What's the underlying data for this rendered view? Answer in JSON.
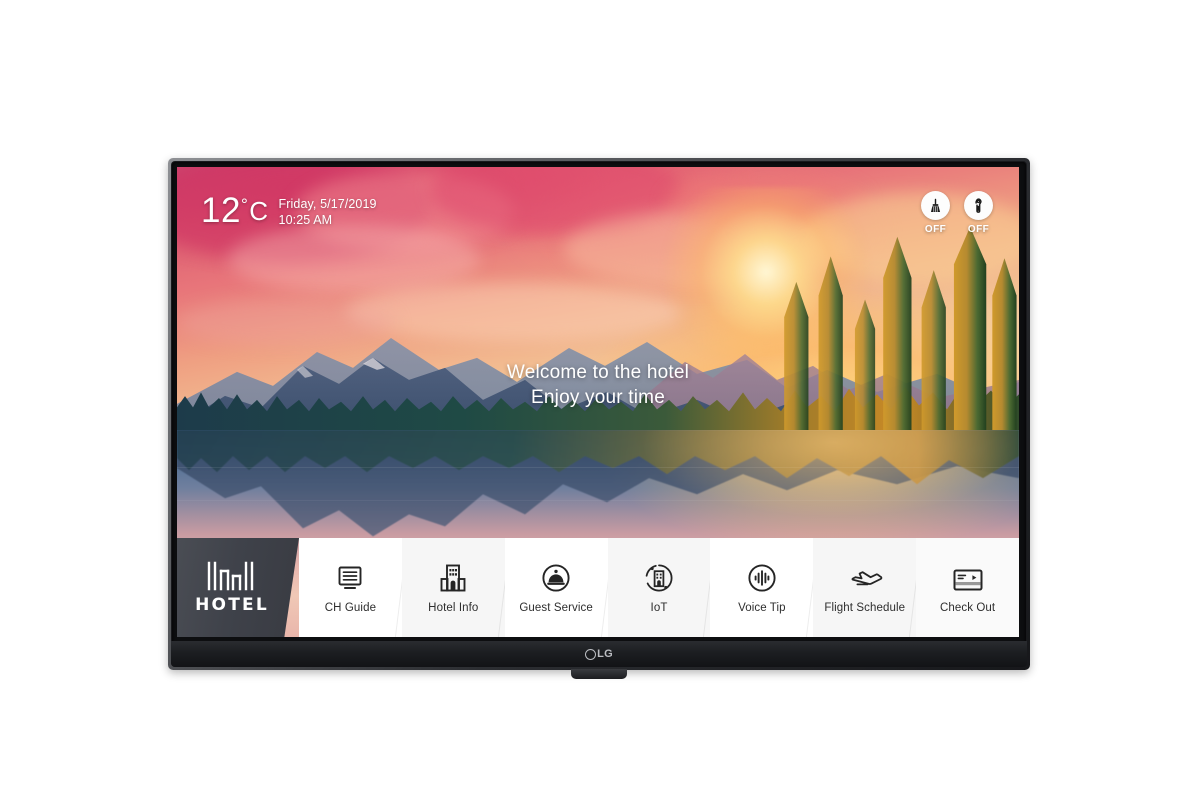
{
  "device": {
    "brand": "LG",
    "chassis_name": "lg-hotel-tv"
  },
  "screen": {
    "weather": {
      "temperature": "12",
      "degree_symbol": "°",
      "unit": "C",
      "date": "Friday, 5/17/2019",
      "time": "10:25 AM"
    },
    "status_icons": [
      {
        "name": "make-up-room-icon",
        "glyph": "broom",
        "state": "OFF"
      },
      {
        "name": "do-not-disturb-icon",
        "glyph": "door-hanger",
        "state": "OFF"
      }
    ],
    "welcome": {
      "line1": "Welcome to the hotel",
      "line2": "Enjoy your time"
    },
    "launcher": {
      "brand_tile": {
        "label": "HOTEL",
        "icon": "hotel-skyline-icon"
      },
      "tiles": [
        {
          "label": "CH Guide",
          "icon": "channel-guide-icon"
        },
        {
          "label": "Hotel Info",
          "icon": "building-icon"
        },
        {
          "label": "Guest Service",
          "icon": "service-bell-icon"
        },
        {
          "label": "IoT",
          "icon": "iot-building-icon"
        },
        {
          "label": "Voice Tip",
          "icon": "voice-waveform-icon"
        },
        {
          "label": "Flight Schedule",
          "icon": "airplane-icon"
        },
        {
          "label": "Check Out",
          "icon": "key-card-icon"
        }
      ]
    }
  },
  "colors": {
    "brand_tile_bg": "#3f424a",
    "launcher_bg": "#ffffff",
    "label_text": "#2e2e2e",
    "osd_text": "#ffffff",
    "bezel": "#18191c"
  }
}
